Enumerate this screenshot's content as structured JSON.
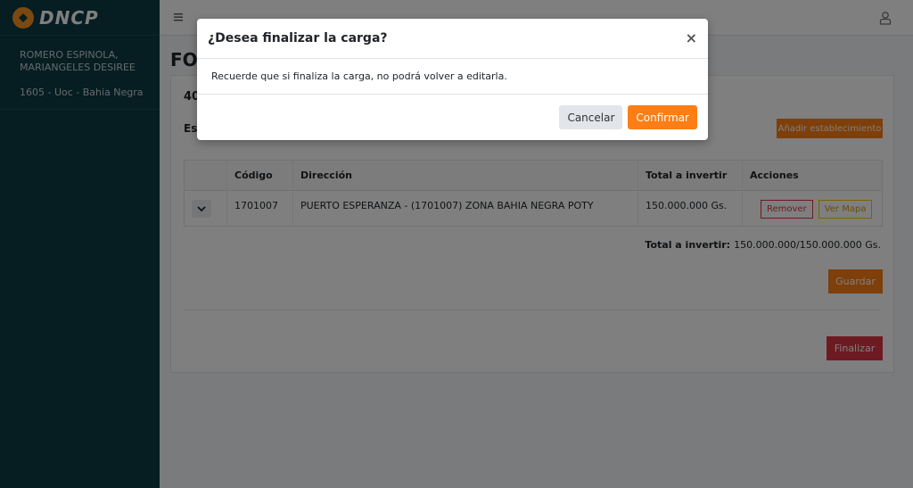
{
  "brand": {
    "name": "DNCP"
  },
  "sidebar": {
    "user_name": "ROMERO ESPINOLA, MARIANGELES DESIREE",
    "unit": "1605 - Uoc - Bahia Negra"
  },
  "page": {
    "title": "FO",
    "card_head": "40",
    "subhead": "Est",
    "add_label": "Añadir establecimiento"
  },
  "table": {
    "headers": [
      "",
      "Código",
      "Dirección",
      "Total a invertir",
      "Acciones"
    ],
    "rows": [
      {
        "code": "1701007",
        "address": "PUERTO ESPERANZA - (1701007) ZONA BAHIA NEGRA POTY",
        "total": "150.000.000 Gs.",
        "remove_label": "Remover",
        "map_label": "Ver Mapa"
      }
    ]
  },
  "totals": {
    "label": "Total a invertir:",
    "value": "150.000.000/150.000.000 Gs."
  },
  "buttons": {
    "save": "Guardar",
    "finish": "Finalizar"
  },
  "modal": {
    "title": "¿Desea finalizar la carga?",
    "close": "×",
    "body": "Recuerde que si finaliza la carga, no podrá volver a editarla.",
    "cancel": "Cancelar",
    "confirm": "Confirmar"
  },
  "colors": {
    "sidebar": "#0d3b45",
    "accent": "#fd7e14",
    "danger": "#dc3545",
    "warning": "#ffc107"
  },
  "icons": {
    "menu": "hamburger-icon",
    "user": "user-icon",
    "expand": "chevron-down-icon",
    "logo": "dncp-logo-icon"
  }
}
